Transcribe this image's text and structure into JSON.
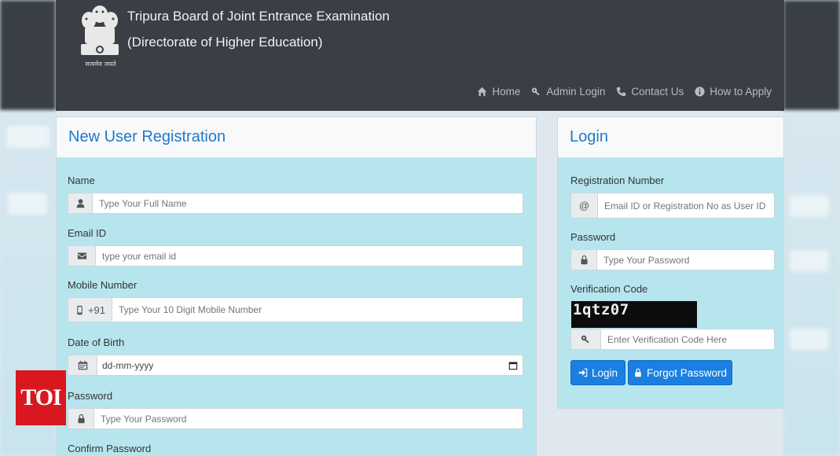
{
  "header": {
    "title": "Tripura Board of Joint Entrance Examination",
    "subtitle": "(Directorate of Higher Education)",
    "emblem_text": "सत्यमेव जयते",
    "bg_color": "#3a3e45"
  },
  "nav": {
    "items": [
      {
        "label": "Home",
        "icon": "home-icon"
      },
      {
        "label": "Admin Login",
        "icon": "key-icon"
      },
      {
        "label": "Contact Us",
        "icon": "phone-icon"
      },
      {
        "label": "How to Apply",
        "icon": "info-icon"
      }
    ]
  },
  "registration": {
    "title": "New User Registration",
    "name_label": "Name",
    "name_placeholder": "Type Your Full Name",
    "email_label": "Email ID",
    "email_placeholder": "type your email id",
    "mobile_label": "Mobile Number",
    "mobile_prefix": "+91",
    "mobile_placeholder": "Type Your 10 Digit Mobile Number",
    "dob_label": "Date of Birth",
    "dob_placeholder": "dd-mm-yyyy",
    "password_label": "Password",
    "password_placeholder": "Type Your Password",
    "confirm_label": "Confirm Password"
  },
  "login": {
    "title": "Login",
    "regno_label": "Registration Number",
    "regno_prefix": "@",
    "regno_placeholder": "Email ID or Registration No as User ID",
    "password_label": "Password",
    "password_placeholder": "Type Your Password",
    "verification_label": "Verification Code",
    "captcha_text": "1qtz07",
    "verification_placeholder": "Enter Verification Code Here",
    "login_button": "Login",
    "forgot_button": "Forgot Password"
  },
  "watermark": "TOI",
  "colors": {
    "accent": "#1f7ac9",
    "panel_bg": "#b7e5ee",
    "button": "#1a7fe0",
    "toi_red": "#d9171f"
  }
}
